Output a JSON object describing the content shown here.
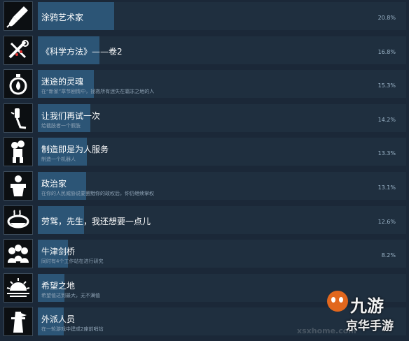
{
  "achievements": [
    {
      "title": "涂鸦艺术家",
      "desc": "",
      "percent_label": "20.8%",
      "percent": 20.8,
      "icon": "paintbrush-icon"
    },
    {
      "title": "《科学方法》——卷2",
      "desc": "",
      "percent_label": "16.8%",
      "percent": 16.8,
      "icon": "tools-icon"
    },
    {
      "title": "迷途的灵魂",
      "desc": "在“新家”章节剧情中，拯救所有迷失在霜冻之地的人",
      "percent_label": "15.3%",
      "percent": 15.3,
      "icon": "lantern-icon"
    },
    {
      "title": "让我们再试一次",
      "desc": "给截肢者一个假肢",
      "percent_label": "14.2%",
      "percent": 14.2,
      "icon": "prosthetic-leg-icon"
    },
    {
      "title": "制造即是为人服务",
      "desc": "制造一个机器人",
      "percent_label": "13.3%",
      "percent": 13.3,
      "icon": "robot-icon"
    },
    {
      "title": "政治家",
      "desc": "在你的人民威胁说要罢黜你的政权后，你仍继续掌权",
      "percent_label": "13.1%",
      "percent": 13.1,
      "icon": "speaker-podium-icon"
    },
    {
      "title": "劳驾，先生，我还想要一点儿",
      "desc": "",
      "percent_label": "12.6%",
      "percent": 12.6,
      "icon": "food-bowl-icon"
    },
    {
      "title": "牛津剑桥",
      "desc": "同时有4个工作站在进行研究",
      "percent_label": "8.2%",
      "percent": 8.2,
      "icon": "scientists-icon"
    },
    {
      "title": "希望之地",
      "desc": "希望值达到最大，无不满值",
      "percent_label": "",
      "percent": 7.2,
      "icon": "sunrise-icon"
    },
    {
      "title": "外派人员",
      "desc": "在一轮游戏中建成2座前哨站",
      "percent_label": "",
      "percent": 7.0,
      "icon": "outpost-tower-icon"
    }
  ],
  "watermark": {
    "brand": "九游",
    "slogan": "京华手游",
    "domain": "xsxhome.com"
  }
}
